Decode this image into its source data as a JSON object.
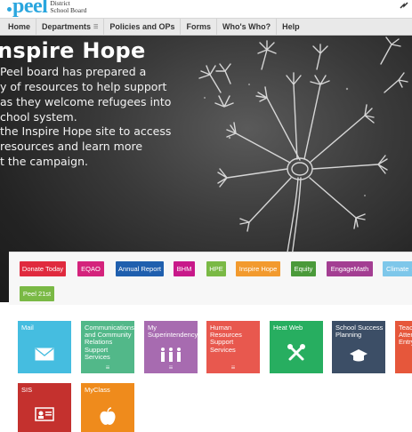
{
  "header": {
    "logo_text": "peel",
    "logo_subtitle_line1": "District",
    "logo_subtitle_line2": "School Board"
  },
  "nav": {
    "items": [
      {
        "label": "Home"
      },
      {
        "label": "Departments",
        "has_menu": true
      },
      {
        "label": "Policies and OPs"
      },
      {
        "label": "Forms"
      },
      {
        "label": "Who's Who?"
      },
      {
        "label": "Help"
      }
    ]
  },
  "hero": {
    "title": "nspire Hope",
    "paragraph1": "Peel board has prepared a variety of resources to help support as they welcome refugees into school system.",
    "p1_lines": [
      "Peel board has prepared a",
      "y of resources to help support",
      "as they welcome refugees into",
      "chool system."
    ],
    "p2_lines": [
      "the Inspire Hope site to access",
      "resources and learn more",
      "t the campaign."
    ]
  },
  "quick_links": [
    {
      "label": "Donate Today",
      "color": "#e02a3e"
    },
    {
      "label": "EQAO",
      "color": "#d4237c"
    },
    {
      "label": "Annual Report",
      "color": "#1f5fae"
    },
    {
      "label": "BHM",
      "color": "#c8198a"
    },
    {
      "label": "HPE",
      "color": "#7ab945"
    },
    {
      "label": "Inspire Hope",
      "color": "#f29a2e"
    },
    {
      "label": "Equity",
      "color": "#4a9a3a"
    },
    {
      "label": "EngageMath",
      "color": "#a33e92"
    },
    {
      "label": "Climate",
      "color": "#7ec7ea"
    },
    {
      "label": "Peel 21st",
      "color": "#7ab945"
    }
  ],
  "tiles": [
    {
      "label": "Mail",
      "color": "#45bde0",
      "icon": "envelope-icon"
    },
    {
      "label": "Communications and Community Relations Support Services",
      "color": "#52b889",
      "icon": "menu-dots"
    },
    {
      "label": "My Superintendency",
      "color": "#a76bb0",
      "icon": "people-icon"
    },
    {
      "label": "Human Resources Support Services",
      "color": "#e8584e",
      "icon": "menu-dots"
    },
    {
      "label": "Heat Web",
      "color": "#27ae60",
      "icon": "tools-icon"
    },
    {
      "label": "School Success Planning",
      "color": "#3c4e66",
      "icon": "graduation-cap-icon"
    },
    {
      "label": "Teacher Attendance Entry",
      "color": "#e6573b",
      "icon": "none"
    },
    {
      "label": "SIS",
      "color": "#c4312e",
      "icon": "id-card-icon"
    },
    {
      "label": "MyClass",
      "color": "#ef8b1c",
      "icon": "apple-icon"
    }
  ]
}
